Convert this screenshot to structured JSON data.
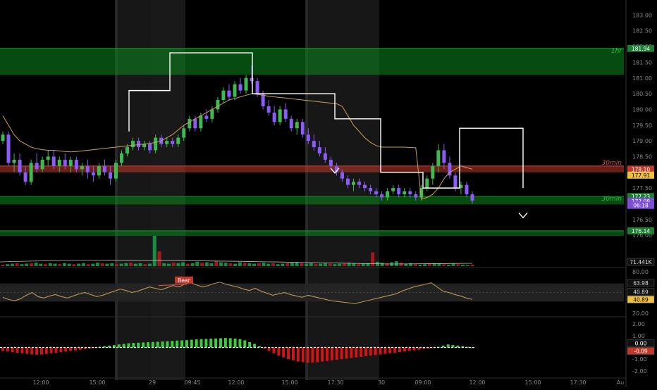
{
  "chart_data": {
    "type": "candlestick",
    "colors": {
      "background": "#000000",
      "bull_candle": "#3fb950",
      "bear_candle": "#8b5cf6",
      "zone_green": "#0b8a1f",
      "zone_red": "#c0392b",
      "vwap_line": "#c8a25a",
      "macd_pos": "#3ecb3e",
      "macd_neg": "#d01515",
      "session_shade": "#2a2a2a",
      "axis_text": "#8a8a8a"
    },
    "x_axis": {
      "tick_labels": [
        "12:00",
        "15:00",
        "29",
        "09:45",
        "12:00",
        "15:00",
        "17:30",
        "30",
        "09:00",
        "12:00",
        "15:00",
        "17:30",
        "Au"
      ]
    },
    "price_axis": {
      "range": [
        175.6,
        183.3
      ],
      "ticks": [
        "183.00",
        "182.50",
        "182.00",
        "181.50",
        "181.00",
        "180.50",
        "180.00",
        "179.50",
        "179.00",
        "178.50",
        "178.00",
        "177.50",
        "177.00",
        "176.50",
        "176.00"
      ]
    },
    "price_badges": [
      {
        "text": "181.94",
        "price": 181.94,
        "color": "#1e7e34"
      },
      {
        "text": "178.10",
        "price": 178.1,
        "color": "#c0392b"
      },
      {
        "text": "177.91",
        "price": 177.91,
        "color": "#f0c040"
      },
      {
        "text": "177.23",
        "price": 177.23,
        "color": "#1e7e34"
      },
      {
        "text": "177.08",
        "price": 177.08,
        "color": "#7b4fd6"
      },
      {
        "text": "06:18",
        "price": 176.95,
        "color": "#7b4fd6"
      },
      {
        "text": "176.14",
        "price": 176.14,
        "color": "#1e7e34"
      }
    ],
    "zones": [
      {
        "label": "1hr",
        "top": 181.94,
        "bottom": 181.1,
        "color": "#0b8a1f",
        "alpha": 0.55
      },
      {
        "label": "30min",
        "top": 178.2,
        "bottom": 178.0,
        "color": "#c0392b",
        "alpha": 0.55
      },
      {
        "label": "30min",
        "top": 177.23,
        "bottom": 176.98,
        "color": "#0b8a1f",
        "alpha": 0.55
      },
      {
        "label": "",
        "top": 176.14,
        "bottom": 175.98,
        "color": "#0b8a1f",
        "alpha": 0.55
      }
    ],
    "zone_labels": [
      "1hr",
      "30min",
      "30min"
    ],
    "candles": [
      [
        179.0,
        179.3,
        178.9,
        179.2
      ],
      [
        179.2,
        179.3,
        178.2,
        178.3
      ],
      [
        178.3,
        178.6,
        178.0,
        178.4
      ],
      [
        178.4,
        178.6,
        177.9,
        178.0
      ],
      [
        178.0,
        178.2,
        177.6,
        177.7
      ],
      [
        177.7,
        178.4,
        177.6,
        178.3
      ],
      [
        178.3,
        178.6,
        178.0,
        178.1
      ],
      [
        178.1,
        178.5,
        178.0,
        178.4
      ],
      [
        178.4,
        178.7,
        178.2,
        178.5
      ],
      [
        178.5,
        178.7,
        178.1,
        178.2
      ],
      [
        178.2,
        178.5,
        178.0,
        178.4
      ],
      [
        178.4,
        178.6,
        178.1,
        178.2
      ],
      [
        178.2,
        178.5,
        178.0,
        178.4
      ],
      [
        178.4,
        178.5,
        178.0,
        178.1
      ],
      [
        178.1,
        178.3,
        177.9,
        178.2
      ],
      [
        178.2,
        178.4,
        177.8,
        178.0
      ],
      [
        178.0,
        178.2,
        177.7,
        177.9
      ],
      [
        177.9,
        178.3,
        177.8,
        178.2
      ],
      [
        178.2,
        178.4,
        177.9,
        178.0
      ],
      [
        178.0,
        178.2,
        177.6,
        177.8
      ],
      [
        177.8,
        178.4,
        177.7,
        178.3
      ],
      [
        178.3,
        178.7,
        178.2,
        178.6
      ],
      [
        178.6,
        178.9,
        178.5,
        178.8
      ],
      [
        178.8,
        179.1,
        178.7,
        179.0
      ],
      [
        179.0,
        179.1,
        178.7,
        178.8
      ],
      [
        178.8,
        179.0,
        178.7,
        178.9
      ],
      [
        178.9,
        179.0,
        178.6,
        178.7
      ],
      [
        178.7,
        179.2,
        178.6,
        179.1
      ],
      [
        179.1,
        179.2,
        178.8,
        178.9
      ],
      [
        178.9,
        179.1,
        178.8,
        179.0
      ],
      [
        179.0,
        179.1,
        178.8,
        178.9
      ],
      [
        178.9,
        179.2,
        178.8,
        179.1
      ],
      [
        179.1,
        179.5,
        179.0,
        179.4
      ],
      [
        179.4,
        179.8,
        179.3,
        179.7
      ],
      [
        179.7,
        179.8,
        179.3,
        179.4
      ],
      [
        179.4,
        179.9,
        179.3,
        179.8
      ],
      [
        179.8,
        180.0,
        179.6,
        179.7
      ],
      [
        179.7,
        180.1,
        179.6,
        180.0
      ],
      [
        180.0,
        180.4,
        179.9,
        180.3
      ],
      [
        180.3,
        180.7,
        180.2,
        180.6
      ],
      [
        180.6,
        180.8,
        180.3,
        180.4
      ],
      [
        180.4,
        180.9,
        180.3,
        180.8
      ],
      [
        180.8,
        181.0,
        180.5,
        180.6
      ],
      [
        180.6,
        181.1,
        180.5,
        181.0
      ],
      [
        181.0,
        181.4,
        180.8,
        180.9
      ],
      [
        180.9,
        181.0,
        180.4,
        180.5
      ],
      [
        180.5,
        180.6,
        180.0,
        180.1
      ],
      [
        180.1,
        180.3,
        179.8,
        179.9
      ],
      [
        179.9,
        180.1,
        179.5,
        179.6
      ],
      [
        179.6,
        180.1,
        179.5,
        180.0
      ],
      [
        180.0,
        180.2,
        179.6,
        179.7
      ],
      [
        179.7,
        179.8,
        179.3,
        179.4
      ],
      [
        179.4,
        179.7,
        179.2,
        179.6
      ],
      [
        179.6,
        179.7,
        179.1,
        179.2
      ],
      [
        179.2,
        179.4,
        178.9,
        179.0
      ],
      [
        179.0,
        179.2,
        178.7,
        178.8
      ],
      [
        178.8,
        179.0,
        178.5,
        178.6
      ],
      [
        178.6,
        178.8,
        178.3,
        178.4
      ],
      [
        178.4,
        178.5,
        178.1,
        178.2
      ],
      [
        178.2,
        178.3,
        177.9,
        178.0
      ],
      [
        178.0,
        178.1,
        177.7,
        177.8
      ],
      [
        177.8,
        177.9,
        177.5,
        177.6
      ],
      [
        177.6,
        177.8,
        177.4,
        177.7
      ],
      [
        177.7,
        177.8,
        177.5,
        177.6
      ],
      [
        177.6,
        177.7,
        177.4,
        177.5
      ],
      [
        177.5,
        177.6,
        177.3,
        177.4
      ],
      [
        177.4,
        177.5,
        177.2,
        177.3
      ],
      [
        177.3,
        177.4,
        177.1,
        177.2
      ],
      [
        177.2,
        177.5,
        177.1,
        177.4
      ],
      [
        177.4,
        177.6,
        177.3,
        177.5
      ],
      [
        177.5,
        177.6,
        177.2,
        177.3
      ],
      [
        177.3,
        177.5,
        177.2,
        177.4
      ],
      [
        177.4,
        177.5,
        177.2,
        177.3
      ],
      [
        177.3,
        177.4,
        177.1,
        177.2
      ],
      [
        177.2,
        177.6,
        177.1,
        177.5
      ],
      [
        177.5,
        177.9,
        177.4,
        177.8
      ],
      [
        177.8,
        178.3,
        177.6,
        178.2
      ],
      [
        178.2,
        178.9,
        178.0,
        178.7
      ],
      [
        178.7,
        178.9,
        178.1,
        178.3
      ],
      [
        178.3,
        178.5,
        177.8,
        177.9
      ],
      [
        177.9,
        178.0,
        177.4,
        177.5
      ],
      [
        177.5,
        177.7,
        177.3,
        177.6
      ],
      [
        177.6,
        177.7,
        177.2,
        177.3
      ],
      [
        177.3,
        177.4,
        177.0,
        177.1
      ]
    ],
    "vwap_line": [
      179.8,
      179.5,
      179.2,
      179.0,
      178.9,
      178.8,
      178.75,
      178.72,
      178.7,
      178.7,
      178.68,
      178.66,
      178.65,
      178.66,
      178.68,
      178.7,
      178.72,
      178.74,
      178.76,
      178.78,
      178.8,
      178.82,
      178.84,
      178.86,
      178.88,
      178.9,
      178.92,
      178.95,
      179.0,
      179.1,
      179.2,
      179.35,
      179.5,
      179.6,
      179.7,
      179.8,
      179.9,
      180.0,
      180.1,
      180.2,
      180.3,
      180.35,
      180.4,
      180.45,
      180.5,
      180.48,
      180.45,
      180.42,
      180.4,
      180.38,
      180.36,
      180.34,
      180.32,
      180.3,
      180.28,
      180.26,
      180.24,
      180.22,
      180.2,
      180.18,
      180.1,
      179.8,
      179.5,
      179.3,
      179.1,
      178.95,
      178.85,
      178.8,
      178.8,
      178.8,
      178.8,
      178.8,
      178.79,
      178.78,
      177.15,
      177.2,
      177.3,
      177.5,
      177.8,
      178.0,
      178.1,
      178.2,
      178.15,
      178.1
    ],
    "step_line": [
      [
        179.3,
        180.6
      ],
      [
        180.6,
        181.8
      ],
      [
        181.8,
        180.5
      ],
      [
        180.5,
        179.7
      ],
      [
        179.7,
        178.0
      ],
      [
        178.0,
        177.5
      ],
      [
        177.5,
        179.4
      ],
      [
        179.4,
        177.5
      ],
      [
        177.5,
        176.6
      ]
    ],
    "volume_axis_badge": "71.441K",
    "volume": [
      3,
      4,
      5,
      6,
      4,
      5,
      6,
      7,
      5,
      4,
      6,
      5,
      4,
      6,
      5,
      4,
      5,
      6,
      4,
      5,
      7,
      6,
      5,
      6,
      4,
      5,
      6,
      7,
      5,
      6,
      4,
      5,
      62,
      30,
      6,
      5,
      7,
      6,
      8,
      5,
      6,
      9,
      7,
      8,
      6,
      10,
      8,
      7,
      6,
      5,
      8,
      7,
      6,
      5,
      6,
      7,
      5,
      6,
      4,
      5,
      6,
      7,
      8,
      6,
      5,
      6,
      4,
      5,
      6,
      5,
      4,
      5,
      6,
      7,
      5,
      4,
      5,
      6,
      28,
      9,
      7,
      6,
      8,
      10,
      7,
      5,
      6,
      4,
      3,
      4,
      5,
      6,
      5,
      4,
      3,
      5,
      4,
      3,
      2,
      3
    ],
    "oscillator": {
      "axis_ticks": [
        "80.00",
        "20.00"
      ],
      "badges": [
        "63.98",
        "40.89",
        "40.89"
      ],
      "label": "Bear",
      "values": [
        43,
        40,
        38,
        41,
        46,
        50,
        44,
        42,
        45,
        47,
        44,
        42,
        45,
        48,
        50,
        47,
        44,
        46,
        49,
        52,
        55,
        53,
        50,
        52,
        55,
        58,
        56,
        54,
        57,
        60,
        58,
        62,
        64,
        61,
        58,
        60,
        63,
        65,
        62,
        60,
        58,
        55,
        53,
        56,
        52,
        49,
        46,
        48,
        50,
        47,
        45,
        43,
        46,
        44,
        42,
        40,
        38,
        37,
        36,
        35,
        34,
        36,
        38,
        40,
        42,
        44,
        46,
        48,
        52,
        55,
        58,
        60,
        62,
        64,
        58,
        52,
        50,
        47,
        45,
        42,
        40
      ],
      "range": [
        20,
        80
      ]
    },
    "macd": {
      "axis_ticks": [
        "2.00",
        "1.00",
        "-1.00",
        "-2.00"
      ],
      "badges": [
        "0.00",
        "-0.09"
      ],
      "range": [
        -2.3,
        2.3
      ],
      "values": [
        -0.3,
        -0.35,
        -0.4,
        -0.45,
        -0.5,
        -0.55,
        -0.6,
        -0.62,
        -0.6,
        -0.55,
        -0.5,
        -0.45,
        -0.4,
        -0.35,
        -0.3,
        -0.25,
        -0.2,
        -0.15,
        -0.1,
        -0.05,
        0.05,
        0.1,
        0.15,
        0.2,
        0.25,
        0.3,
        0.35,
        0.38,
        0.4,
        0.42,
        0.44,
        0.46,
        0.48,
        0.5,
        0.52,
        0.55,
        0.58,
        0.6,
        0.62,
        0.65,
        0.68,
        0.7,
        0.72,
        0.74,
        0.76,
        0.78,
        0.8,
        0.78,
        0.75,
        0.7,
        0.6,
        0.45,
        0.3,
        0.1,
        -0.1,
        -0.3,
        -0.5,
        -0.7,
        -0.85,
        -1.0,
        -1.1,
        -1.2,
        -1.25,
        -1.3,
        -1.28,
        -1.25,
        -1.2,
        -1.15,
        -1.1,
        -1.05,
        -1.0,
        -0.95,
        -0.9,
        -0.85,
        -0.8,
        -0.75,
        -0.7,
        -0.65,
        -0.6,
        -0.55,
        -0.5,
        -0.45,
        -0.4,
        -0.35,
        -0.3,
        -0.25,
        -0.2,
        -0.15,
        -0.1,
        -0.05,
        0.05,
        0.15,
        0.25,
        0.2,
        0.15,
        0.1,
        0.05,
        0.0
      ]
    }
  }
}
